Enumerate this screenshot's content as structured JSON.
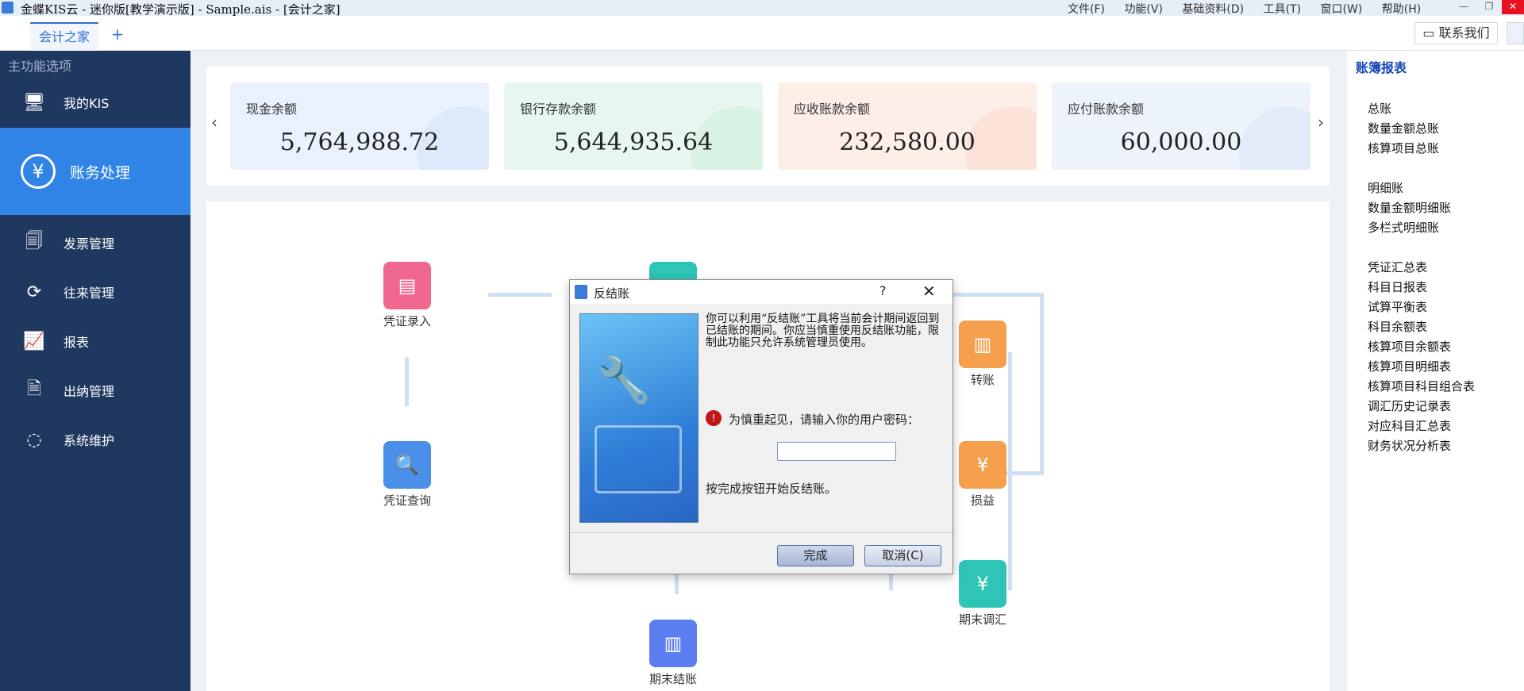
{
  "window": {
    "title": "金蝶KIS云 - 迷你版[教学演示版] - Sample.ais - [会计之家]"
  },
  "menu": [
    "文件(F)",
    "功能(V)",
    "基础资料(D)",
    "工具(T)",
    "窗口(W)",
    "帮助(H)"
  ],
  "tabs": {
    "home": "会计之家",
    "add": "+"
  },
  "contact": "联系我们",
  "sidebar": {
    "header": "主功能选项",
    "items": [
      {
        "label": "我的KIS",
        "icon": "monitor-icon"
      },
      {
        "label": "账务处理",
        "icon": "yen-shield-icon"
      },
      {
        "label": "发票管理",
        "icon": "invoice-icon"
      },
      {
        "label": "往来管理",
        "icon": "yen-exchange-icon"
      },
      {
        "label": "报表",
        "icon": "presentation-icon"
      },
      {
        "label": "出纳管理",
        "icon": "cashier-icon"
      },
      {
        "label": "系统维护",
        "icon": "system-icon"
      }
    ]
  },
  "cards": [
    {
      "label": "现金余额",
      "value": "5,764,988.72",
      "bg": "#e9f1fc",
      "deco": "#cfe0f8"
    },
    {
      "label": "银行存款余额",
      "value": "5,644,935.64",
      "bg": "#e7f7ef",
      "deco": "#c6ecd8"
    },
    {
      "label": "应收账款余额",
      "value": "232,580.00",
      "bg": "#fdeee8",
      "deco": "#f8d5c7"
    },
    {
      "label": "应付账款余额",
      "value": "60,000.00",
      "bg": "#edf3fb",
      "deco": "#d5e3f5"
    }
  ],
  "flow": {
    "voucher_entry": "凭证录入",
    "voucher_query": "凭证查询",
    "transfer_suffix": "转账",
    "profit_suffix": "损益",
    "period_adjust": "期末调汇",
    "period_close": "期末结账"
  },
  "right_panel": {
    "title": "账簿报表",
    "groups": [
      [
        "总账",
        "数量金额总账",
        "核算项目总账"
      ],
      [
        "明细账",
        "数量金额明细账",
        "多栏式明细账"
      ],
      [
        "凭证汇总表",
        "科目日报表",
        "试算平衡表",
        "科目余额表",
        "核算项目余额表",
        "核算项目明细表",
        "核算项目科目组合表",
        "调汇历史记录表",
        "对应科目汇总表",
        "财务状况分析表"
      ]
    ]
  },
  "dialog": {
    "title": "反结账",
    "help": "?",
    "close": "✕",
    "description": "你可以利用“反结账”工具将当前会计期间返回到已结账的期间。你应当慎重使用反结账功能，限制此功能只允许系统管理员使用。",
    "prompt": "为慎重起见，请输入你的用户密码：",
    "note": "按完成按钮开始反结账。",
    "ok": "完成",
    "cancel": "取消(C)"
  }
}
